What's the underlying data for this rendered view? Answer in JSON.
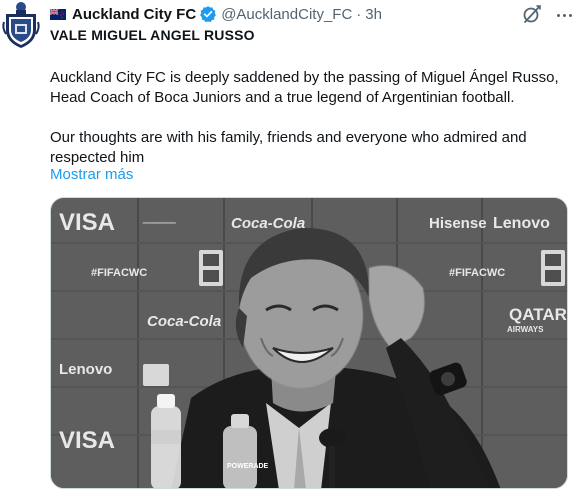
{
  "tweet": {
    "display_name": "Auckland City FC",
    "handle": "@AucklandCity_FC",
    "separator": "·",
    "time_ago": "3h",
    "headline": "VALE MIGUEL ANGEL RUSSO",
    "paragraphs": [
      "Auckland City FC is deeply saddened by the passing of Miguel Ángel Russo, Head Coach of Boca Juniors and a true legend of Argentinian football.",
      "Our thoughts are with his family, friends and everyone who admired and respected him"
    ],
    "show_more": "Mostrar más"
  },
  "icons": {
    "avatar": "club-crest-icon",
    "flag": "new-zealand-flag-icon",
    "verified": "verified-badge-icon",
    "grok": "grok-icon",
    "more": "more-options-icon"
  },
  "photo": {
    "board_text": {
      "visa": "VISA",
      "hisense": "Hisense",
      "lenovo": "Lenovo",
      "fifacwc": "#FIFACWC",
      "cocacola": "Coca-Cola",
      "qatar": "QATAR",
      "airways": "AIRWAYS",
      "bottle": "POWERADE"
    }
  },
  "colors": {
    "link": "#1d9bf0",
    "verified": "#1d9bf0",
    "secondary_text": "#536471",
    "primary_text": "#0f1419"
  }
}
